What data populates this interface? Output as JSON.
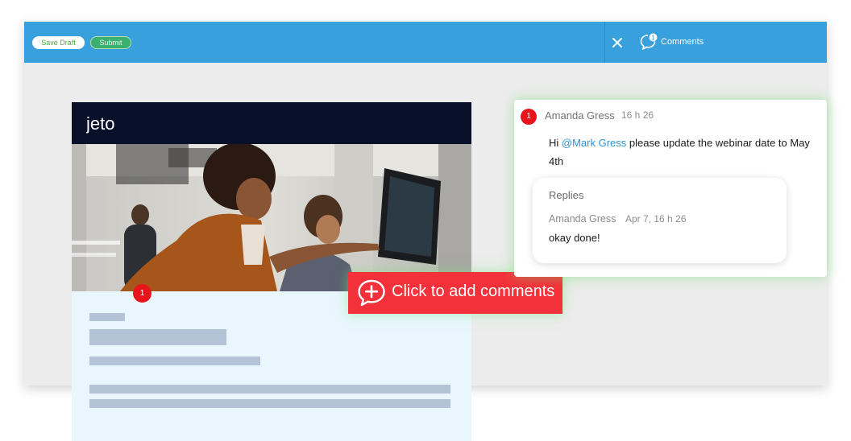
{
  "toolbar": {
    "save_draft_label": "Save Draft",
    "submit_label": "Submit",
    "comments_label": "Comments",
    "comments_count": "1"
  },
  "email": {
    "logo_text": "jeto",
    "pin_number": "1"
  },
  "add_comment": {
    "label": "Click to add comments"
  },
  "comment": {
    "badge": "1",
    "author": "Amanda Gress",
    "time": "16 h 26",
    "text_before": "Hi ",
    "mention": "@Mark Gress",
    "text_after": " please update the webinar date to May 4th",
    "replies_title": "Replies",
    "reply": {
      "author": "Amanda Gress",
      "time": "Apr 7, 16 h 26",
      "text": "okay done!"
    }
  },
  "colors": {
    "toolbar": "#38a0dc",
    "accent_red": "#f3313a",
    "pin_red": "#e8141c",
    "email_header": "#08102a",
    "mention_blue": "#2e94d2",
    "highlight_glow": "#6edc6e"
  }
}
